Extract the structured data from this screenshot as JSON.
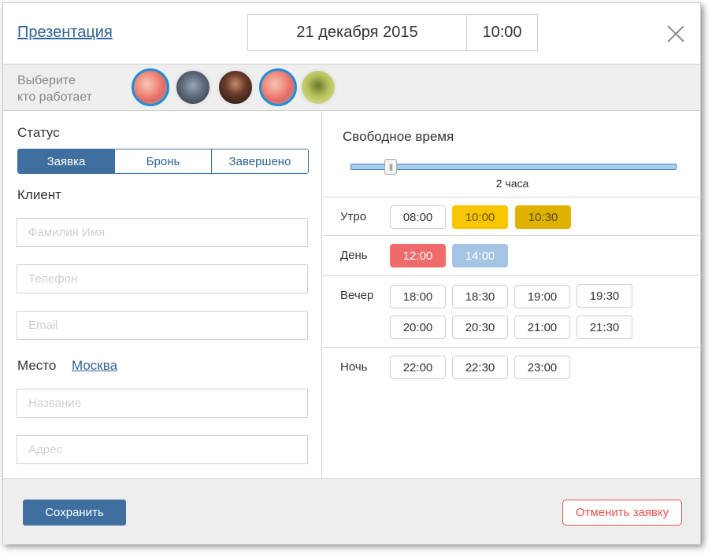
{
  "header": {
    "title": "Презентация",
    "date": "21 декабря 2015",
    "time": "10:00",
    "close_icon": "close-icon"
  },
  "workers": {
    "label_line1": "Выберите",
    "label_line2": "кто работает",
    "selected_color": "#1e8fd6",
    "avatars": [
      {
        "selected": true
      },
      {
        "selected": false
      },
      {
        "selected": false
      },
      {
        "selected": true
      },
      {
        "selected": false
      }
    ]
  },
  "status": {
    "label": "Статус",
    "options": [
      "Заявка",
      "Бронь",
      "Завершено"
    ],
    "active": "Заявка"
  },
  "client": {
    "label": "Клиент",
    "name_placeholder": "Фамилия Имя",
    "phone_placeholder": "Телефон",
    "email_placeholder": "Email"
  },
  "place": {
    "label": "Место",
    "city": "Москва",
    "name_placeholder": "Название",
    "address_placeholder": "Адрес"
  },
  "free_time": {
    "title": "Свободное время",
    "value_label": "2 часа",
    "slider_fraction": 0.12
  },
  "slots": {
    "morning": {
      "label": "Утро",
      "times": [
        {
          "time": "08:00",
          "state": "free"
        },
        {
          "time": "10:00",
          "state": "yellow"
        },
        {
          "time": "10:30",
          "state": "olive"
        }
      ]
    },
    "day": {
      "label": "День",
      "times": [
        {
          "time": "12:00",
          "state": "red"
        },
        {
          "time": "14:00",
          "state": "blue"
        }
      ]
    },
    "evening": {
      "label": "Вечер",
      "times": [
        {
          "time": "18:00",
          "state": "free"
        },
        {
          "time": "18:30",
          "state": "free"
        },
        {
          "time": "19:00",
          "state": "free"
        },
        {
          "time": "19:30",
          "state": "free"
        },
        {
          "time": "20:00",
          "state": "free"
        },
        {
          "time": "20:30",
          "state": "free"
        },
        {
          "time": "21:00",
          "state": "free"
        },
        {
          "time": "21:30",
          "state": "free"
        }
      ]
    },
    "night": {
      "label": "Ночь",
      "times": [
        {
          "time": "22:00",
          "state": "free"
        },
        {
          "time": "22:30",
          "state": "free"
        },
        {
          "time": "23:00",
          "state": "free"
        }
      ]
    }
  },
  "footer": {
    "save_label": "Сохранить",
    "cancel_label": "Отменить заявку"
  },
  "colors": {
    "primary": "#3f6f9f",
    "link": "#2f6496",
    "danger": "#e25050",
    "slot_yellow": "#f8c600",
    "slot_olive": "#dfb200",
    "slot_red": "#ef6b6b",
    "slot_blue": "#a3c4e2"
  }
}
